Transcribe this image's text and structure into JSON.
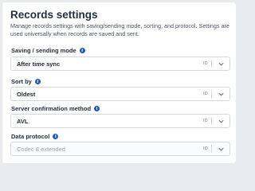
{
  "panel": {
    "title": "Records settings",
    "description": "Manage records settings with saving/sending mode, sorting, and protocol. Settings are used universally when records are saved and sent."
  },
  "fields": [
    {
      "label": "Saving / sending mode",
      "value": "After time sync",
      "badge": "ID",
      "disabled": false
    },
    {
      "label": "Sort by",
      "value": "Oldest",
      "badge": "ID",
      "disabled": false
    },
    {
      "label": "Server confirmation method",
      "value": "AVL",
      "badge": "ID",
      "disabled": false
    },
    {
      "label": "Data protocol",
      "value": "Codec 8 extended",
      "badge": "ID",
      "disabled": true
    }
  ],
  "icons": {
    "info": "info-icon",
    "dropdown": "chevron-down-icon"
  },
  "colors": {
    "accent": "#1f57c3",
    "background": "#e9ebee"
  }
}
